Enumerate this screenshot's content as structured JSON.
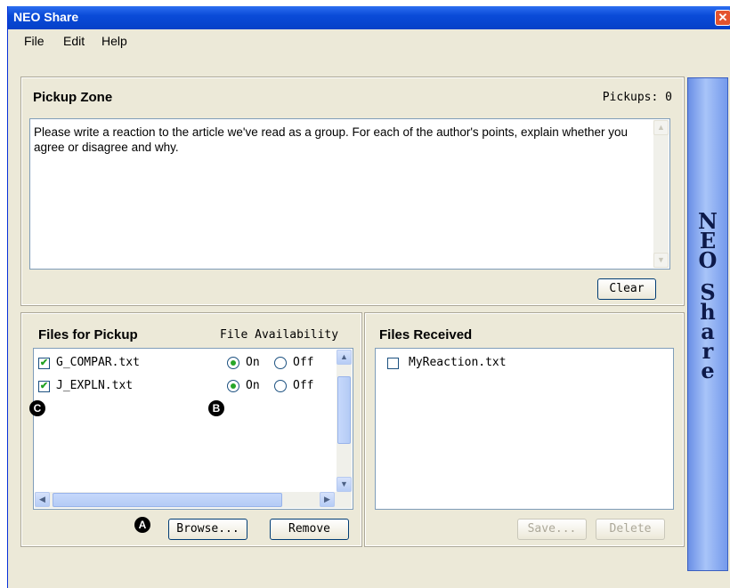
{
  "window": {
    "title": "NEO Share",
    "close_glyph": "✕"
  },
  "menu": [
    "File",
    "Edit",
    "Help"
  ],
  "pickup_zone": {
    "title": "Pickup Zone",
    "pickups": "Pickups: 0",
    "text": "Please write a reaction to the article we've read as a group. For each of the author's points, explain whether you agree or disagree and why.",
    "clear_label": "Clear"
  },
  "files_for_pickup": {
    "title": "Files for Pickup",
    "availability_header": "File Availability",
    "files": [
      {
        "name": "G_COMPAR.txt",
        "checked": true,
        "availability": "On",
        "on_label": "On",
        "off_label": "Off"
      },
      {
        "name": "J_EXPLN.txt",
        "checked": true,
        "availability": "On",
        "on_label": "On",
        "off_label": "Off"
      }
    ],
    "browse_label": "Browse...",
    "remove_label": "Remove"
  },
  "files_received": {
    "title": "Files Received",
    "files": [
      {
        "name": "MyReaction.txt",
        "checked": false
      }
    ],
    "save_label": "Save...",
    "delete_label": "Delete"
  },
  "sidebar": {
    "word1": "NEO",
    "word2": "Share"
  },
  "callouts": {
    "a": "A",
    "b": "B",
    "c": "C"
  },
  "colors": {
    "titlebar": "#0a4bd8",
    "sidebar": "#8fb0f2",
    "check": "#21a121"
  }
}
